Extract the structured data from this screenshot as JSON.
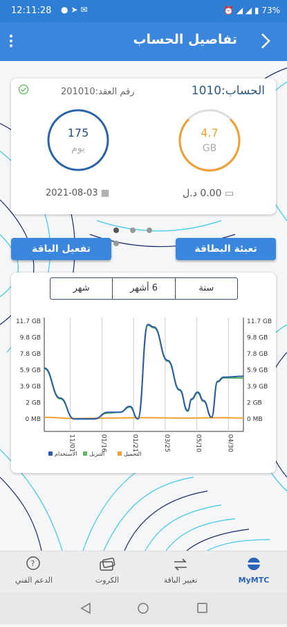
{
  "status": {
    "time": "12:11:28",
    "battery": "73%"
  },
  "header": {
    "title": "تفاصيل الحساب"
  },
  "account": {
    "account_label": "الحساب:1010",
    "contract_label": "رقم العقد:201010",
    "data_value": "4.7",
    "data_unit": "GB",
    "days_value": "175",
    "days_unit": "يوم",
    "balance": "0.00 د.ل",
    "expiry": "2021-08-03",
    "colors": {
      "data": "#f0a030",
      "days": "#2a64a8"
    }
  },
  "buttons": {
    "activate": "تفعيل الباقة",
    "recharge": "تعبئة البطاقة"
  },
  "periods": [
    "شهر",
    "6 أشهر",
    "سنة"
  ],
  "chart_data": {
    "type": "line",
    "y_ticks": [
      "11.7 GB",
      "9.8 GB",
      "7.8 GB",
      "5.9 GB",
      "3.9 GB",
      "2 GB",
      "0 MB"
    ],
    "x_ticks": [
      "11/01",
      "01/16",
      "01/21",
      "03/25",
      "05/10",
      "04/30"
    ],
    "ylim": [
      0,
      11.7
    ],
    "xlim": [
      0,
      100
    ],
    "series": [
      {
        "name": "الاستخدام",
        "color": "#2a5aa8",
        "points": [
          [
            0,
            6.1
          ],
          [
            8,
            2.5
          ],
          [
            15,
            0
          ],
          [
            25,
            0
          ],
          [
            32,
            0.8
          ],
          [
            38,
            0.8
          ],
          [
            43,
            1.5
          ],
          [
            47,
            0
          ],
          [
            52,
            11.3
          ],
          [
            55,
            11
          ],
          [
            62,
            7
          ],
          [
            68,
            3.5
          ],
          [
            72,
            1
          ],
          [
            74,
            2.4
          ],
          [
            77,
            3.2
          ],
          [
            80,
            2.2
          ],
          [
            84,
            0.2
          ],
          [
            87,
            4.5
          ],
          [
            90,
            5
          ],
          [
            100,
            5.1
          ]
        ]
      },
      {
        "name": "التنزيل",
        "color": "#5cb85c",
        "points": [
          [
            0,
            6
          ],
          [
            8,
            2.4
          ],
          [
            15,
            0
          ],
          [
            25,
            0
          ],
          [
            32,
            0.7
          ],
          [
            38,
            0.8
          ],
          [
            43,
            1.4
          ],
          [
            47,
            0
          ],
          [
            52,
            11.2
          ],
          [
            55,
            10.9
          ],
          [
            62,
            6.9
          ],
          [
            68,
            3.4
          ],
          [
            72,
            0.9
          ],
          [
            74,
            2.3
          ],
          [
            77,
            3.1
          ],
          [
            80,
            2.1
          ],
          [
            84,
            0.2
          ],
          [
            87,
            4.4
          ],
          [
            90,
            4.9
          ],
          [
            100,
            4.9
          ]
        ]
      },
      {
        "name": "التحميل",
        "color": "#f0a030",
        "points": [
          [
            0,
            0.2
          ],
          [
            15,
            0.05
          ],
          [
            30,
            0.1
          ],
          [
            50,
            0.15
          ],
          [
            70,
            0.1
          ],
          [
            90,
            0.15
          ],
          [
            100,
            0.1
          ]
        ]
      }
    ],
    "legend": [
      "الاستخدام",
      "التنزيل",
      "التحميل"
    ]
  },
  "nav": {
    "items": [
      {
        "label": "MyMTC",
        "icon": "mtc-logo-icon"
      },
      {
        "label": "تغيير الباقة",
        "icon": "swap-icon"
      },
      {
        "label": "الكروت",
        "icon": "cards-icon"
      },
      {
        "label": "الدعم الفني",
        "icon": "help-chat-icon"
      }
    ]
  }
}
